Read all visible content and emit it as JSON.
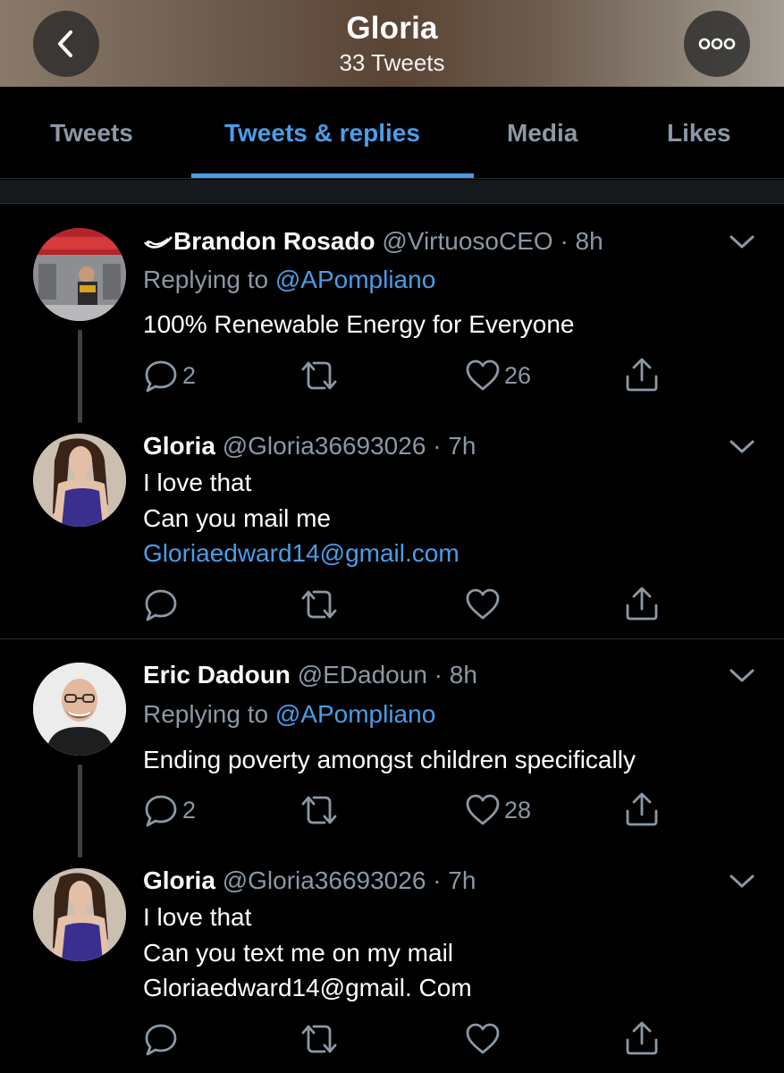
{
  "header": {
    "title": "Gloria",
    "subtitle": "33 Tweets",
    "back_icon": "chevron-left-icon",
    "more_icon": "ellipsis-icon"
  },
  "tabs": [
    {
      "label": "Tweets",
      "active": false
    },
    {
      "label": "Tweets & replies",
      "active": true
    },
    {
      "label": "Media",
      "active": false
    },
    {
      "label": "Likes",
      "active": false
    }
  ],
  "colors": {
    "accent": "#4a9de8",
    "muted": "#8b98a5",
    "background": "#000000"
  },
  "tweets": [
    {
      "name": "Brandon Rosado",
      "handle": "@VirtuosoCEO",
      "time": "· 8h",
      "name_prefix_icon": "wing-logo-icon",
      "replying_prefix": "Replying to",
      "replying_to": "@APompliano",
      "lines": [
        "100% Renewable Energy for Everyone"
      ],
      "replies": "2",
      "likes": "26"
    },
    {
      "name": "Gloria",
      "handle": "@Gloria36693026",
      "time": "· 7h",
      "lines": [
        "I love that",
        "Can you mail me"
      ],
      "link": "Gloriaedward14@gmail.com"
    },
    {
      "name": "Eric Dadoun",
      "handle": "@EDadoun",
      "time": "· 8h",
      "replying_prefix": "Replying to",
      "replying_to": "@APompliano",
      "lines": [
        "Ending poverty amongst children specifically"
      ],
      "replies": "2",
      "likes": "28"
    },
    {
      "name": "Gloria",
      "handle": "@Gloria36693026",
      "time": "· 7h",
      "lines": [
        "I love that",
        "Can you text me on my mail",
        "Gloriaedward14@gmail. Com"
      ]
    }
  ]
}
